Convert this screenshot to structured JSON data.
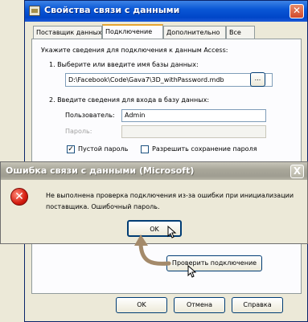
{
  "back_window": {
    "title": "Свойства связи с данными",
    "tabs": [
      "Поставщик данных",
      "Подключение",
      "Дополнительно",
      "Все"
    ],
    "intro": "Укажите сведения для подключения к данным Access:",
    "step1_label": "1. Выберите или введите имя базы данных:",
    "db_path": "D:\\Facebook\\Code\\Gava7\\3D_withPassword.mdb",
    "browse_button": "...",
    "step2_label": "2. Введите сведения для входа в базу данных:",
    "user_label": "Пользователь:",
    "user_value": "Admin",
    "password_label": "Пароль:",
    "password_value": "",
    "blank_password_label": "Пустой пароль",
    "blank_password_checked": true,
    "save_password_label": "Разрешить сохранение пароля",
    "save_password_checked": false,
    "test_connection_button": "Проверить подключение",
    "ok_button": "OK",
    "cancel_button": "Отмена",
    "help_button": "Справка"
  },
  "error_dialog": {
    "title": "Ошибка связи с данными (Microsoft)",
    "icon": "error-icon",
    "message": "Не выполнена проверка подключения из-за ошибки при инициализации поставщика. Ошибочный пароль.",
    "ok_button": "OK",
    "close_glyph": "X"
  },
  "colors": {
    "xp_blue_title": "#0a57d6",
    "inactive_title": "#a9a79a",
    "arrow": "#a48a6a",
    "error_red": "#d41c10"
  }
}
